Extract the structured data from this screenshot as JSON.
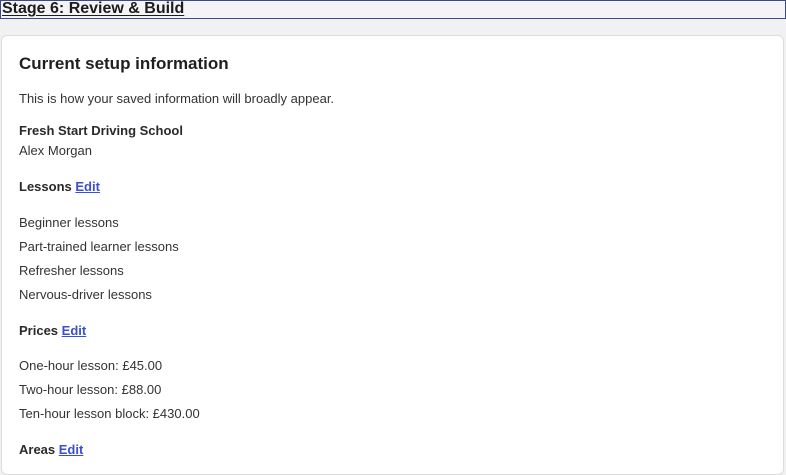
{
  "header": {
    "stage_title": "Stage 6: Review & Build"
  },
  "card": {
    "title": "Current setup information",
    "intro": "This is how your saved information will broadly appear.",
    "business_name": "Fresh Start Driving School",
    "owner_name": "Alex Morgan",
    "edit_label": "Edit",
    "lessons": {
      "heading": "Lessons",
      "items": [
        "Beginner lessons",
        "Part-trained learner lessons",
        "Refresher lessons",
        "Nervous-driver lessons"
      ]
    },
    "prices": {
      "heading": "Prices",
      "items": [
        "One-hour lesson: £45.00",
        "Two-hour lesson: £88.00",
        "Ten-hour lesson block: £430.00"
      ]
    },
    "areas": {
      "heading": "Areas"
    }
  }
}
